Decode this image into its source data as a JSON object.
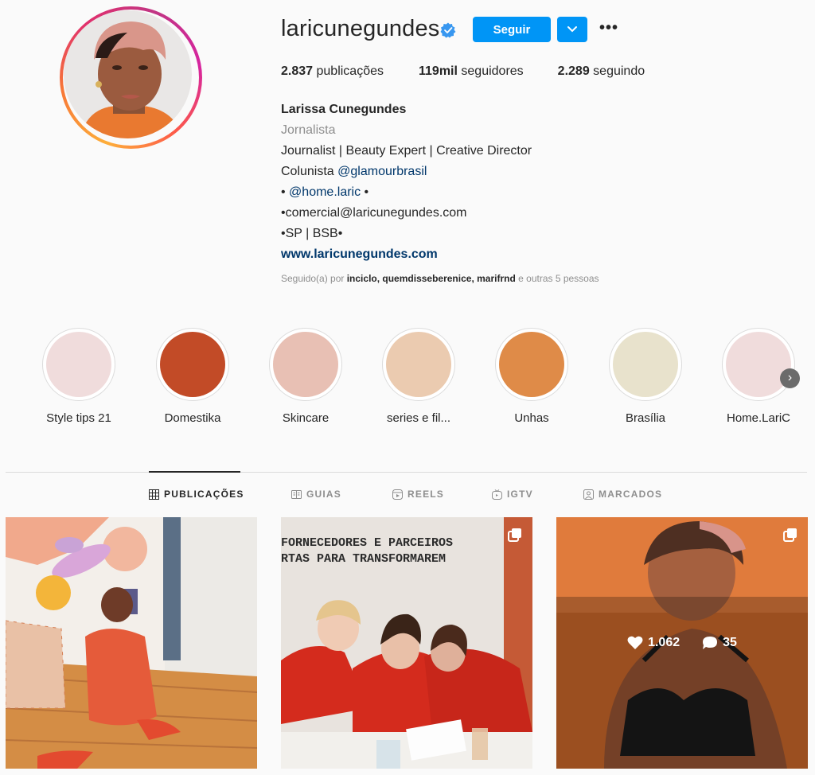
{
  "profile": {
    "username": "laricunegundes",
    "follow_label": "Seguir",
    "more_label": "•••",
    "stats": [
      {
        "count": "2.837",
        "label": "publicações"
      },
      {
        "count": "119mil",
        "label": "seguidores"
      },
      {
        "count": "2.289",
        "label": "seguindo"
      }
    ],
    "full_name": "Larissa Cunegundes",
    "category": "Jornalista",
    "bio_line1": "Journalist | Beauty Expert | Creative Director",
    "bio_line2_prefix": "Colunista ",
    "bio_line2_mention": "@glamourbrasil",
    "bio_line3_prefix": "• ",
    "bio_line3_mention": "@home.laric",
    "bio_line3_suffix": " •",
    "bio_line4": "•comercial@laricunegundes.com",
    "bio_line5": "•SP | BSB•",
    "website": "www.laricunegundes.com",
    "followed_by_prefix": "Seguido(a) por ",
    "followed_by_names": "inciclo, quemdisseberenice, marifrnd",
    "followed_by_suffix": " e outras 5 pessoas"
  },
  "highlights": [
    {
      "label": "Style tips 21",
      "color": "#f0dcdc"
    },
    {
      "label": "Domestika",
      "color": "#c24b27"
    },
    {
      "label": "Skincare",
      "color": "#e8c0b4"
    },
    {
      "label": "series e fil...",
      "color": "#ebcbb0"
    },
    {
      "label": "Unhas",
      "color": "#df8b48"
    },
    {
      "label": "Brasília",
      "color": "#e8e2cc"
    },
    {
      "label": "Home.LariC",
      "color": "#f0dcdc"
    }
  ],
  "tabs": {
    "publicacoes": "PUBLICAÇÕES",
    "guias": "GUIAS",
    "reels": "REELS",
    "igtv": "IGTV",
    "marcados": "MARCADOS"
  },
  "posts": [
    {
      "caption": ""
    },
    {
      "sign_line1": "FORNECEDORES E PARCEIROS",
      "sign_line2": "RTAS PARA TRANSFORMAREM"
    },
    {
      "likes": "1.062",
      "comments": "35"
    }
  ],
  "colors": {
    "accent": "#0095f6",
    "verified": "#3897f0"
  }
}
